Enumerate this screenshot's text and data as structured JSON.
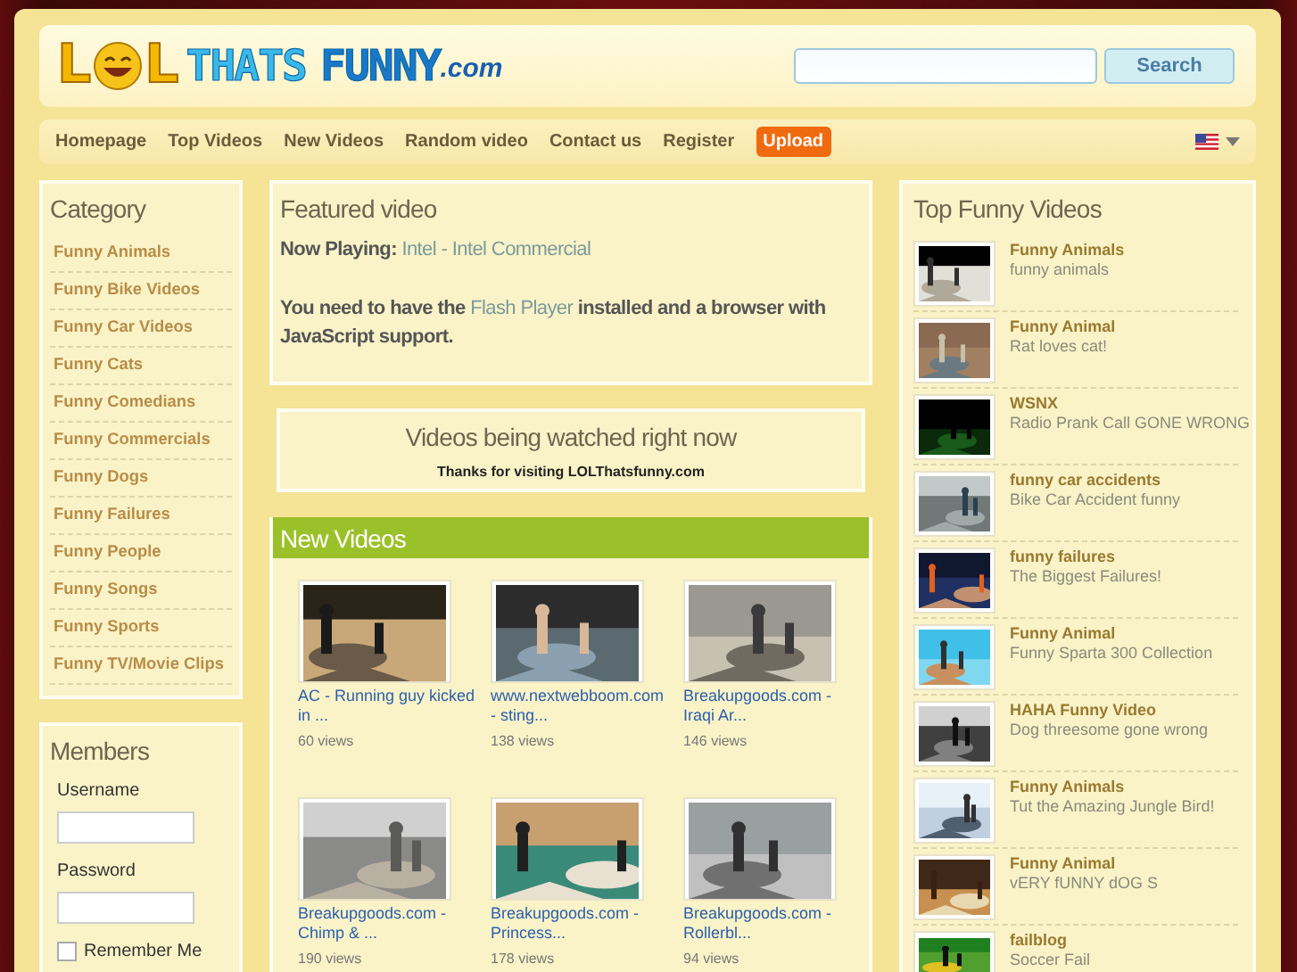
{
  "logo": {
    "letter_left": "L",
    "letter_right": "L",
    "word1": "THATS",
    "word2": "FUNNY",
    "tld": ".com"
  },
  "search": {
    "button": "Search"
  },
  "nav": [
    {
      "label": "Homepage",
      "kind": "link"
    },
    {
      "label": "Top Videos",
      "kind": "link"
    },
    {
      "label": "New Videos",
      "kind": "link"
    },
    {
      "label": "Random video",
      "kind": "link"
    },
    {
      "label": "Contact us",
      "kind": "link"
    },
    {
      "label": "Register",
      "kind": "link"
    },
    {
      "label": "Upload",
      "kind": "highlight"
    }
  ],
  "category": {
    "title": "Category",
    "items": [
      "Funny Animals",
      "Funny Bike Videos",
      "Funny Car Videos",
      "Funny Cats",
      "Funny Comedians",
      "Funny Commercials",
      "Funny Dogs",
      "Funny Failures",
      "Funny People",
      "Funny Songs",
      "Funny Sports",
      "Funny TV/Movie Clips"
    ]
  },
  "members": {
    "title": "Members",
    "username_label": "Username",
    "password_label": "Password",
    "remember": {
      "label": "Remember Me",
      "checked": false
    }
  },
  "featured": {
    "title": "Featured video",
    "now_playing_label": "Now Playing:",
    "now_playing": "Intel - Intel Commercial",
    "notice_before": "You need to have the",
    "notice_link": "Flash Player",
    "notice_after": "installed and a browser with JavaScript support."
  },
  "watching": {
    "title": "Videos being watched right now",
    "subtitle": "Thanks for visiting LOLThatsfunny.com"
  },
  "new_videos": {
    "title": "New Videos",
    "videos": [
      {
        "title": "AC - Running guy kicked in ...",
        "views": "60 views"
      },
      {
        "title": "www.nextwebboom.com - sting...",
        "views": "138 views"
      },
      {
        "title": "Breakupgoods.com - Iraqi Ar...",
        "views": "146 views"
      },
      {
        "title": "Breakupgoods.com - Chimp & ...",
        "views": "190 views"
      },
      {
        "title": "Breakupgoods.com - Princess...",
        "views": "178 views"
      },
      {
        "title": "Breakupgoods.com - Rollerbl...",
        "views": "94 views"
      }
    ]
  },
  "top_videos": {
    "title": "Top Funny Videos",
    "items": [
      {
        "category": "Funny Animals",
        "title": "funny animals"
      },
      {
        "category": "Funny Animal",
        "title": "Rat loves cat!"
      },
      {
        "category": "WSNX",
        "title": "Radio Prank Call GONE WRONG"
      },
      {
        "category": "funny car accidents",
        "title": "Bike Car Accident funny"
      },
      {
        "category": "funny failures",
        "title": "The Biggest Failures!"
      },
      {
        "category": "Funny Animal",
        "title": "Funny Sparta 300 Collection"
      },
      {
        "category": "HAHA Funny Video",
        "title": "Dog threesome gone wrong"
      },
      {
        "category": "Funny Animals",
        "title": "Tut the Amazing Jungle Bird!"
      },
      {
        "category": "Funny Animal",
        "title": "vERY fUNNY dOG S"
      },
      {
        "category": "failblog",
        "title": "Soccer Fail"
      }
    ]
  }
}
